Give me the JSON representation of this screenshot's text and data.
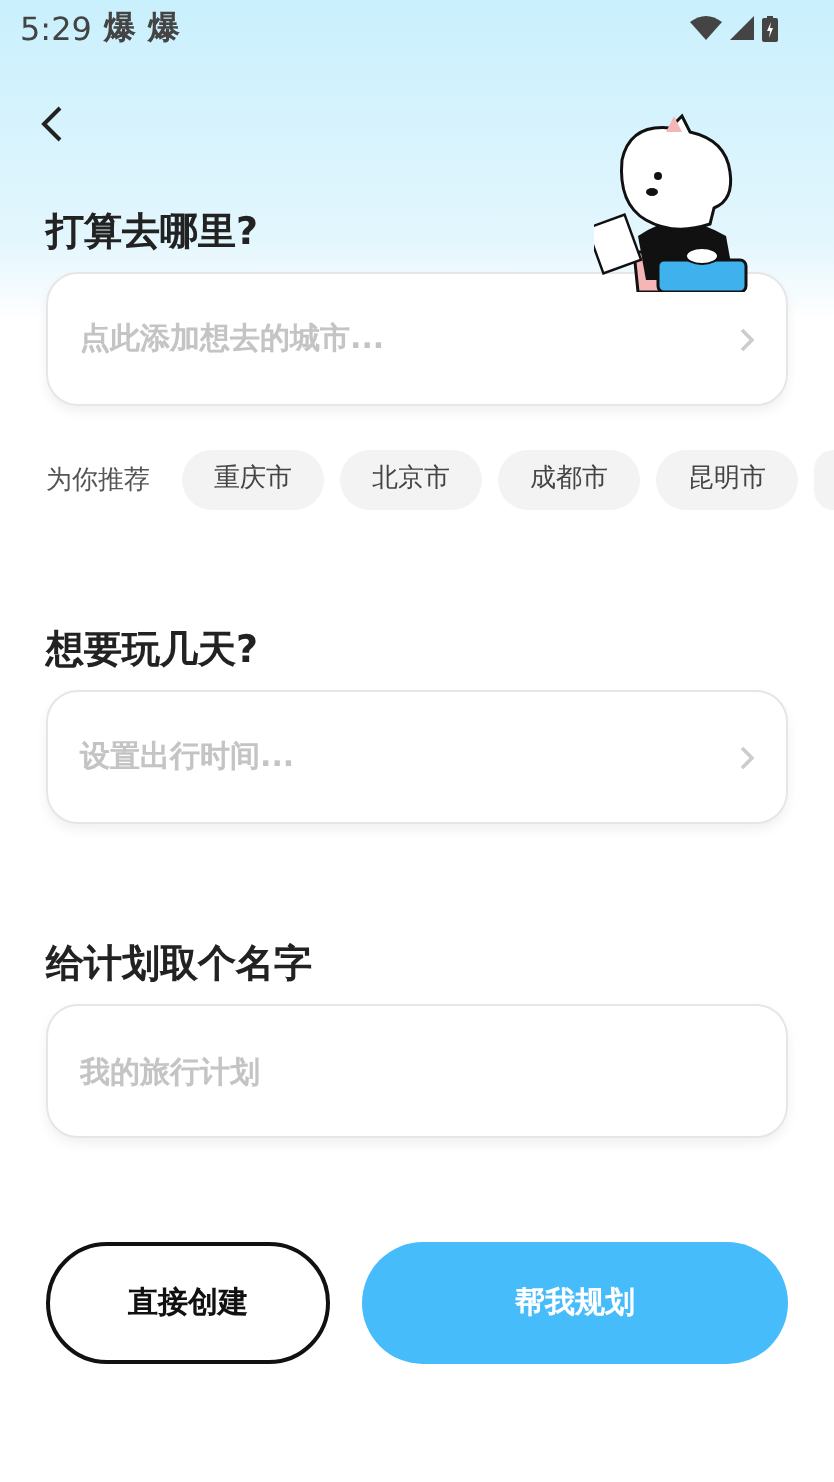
{
  "status_bar": {
    "time": "5:29",
    "notifications": [
      "爆",
      "爆"
    ]
  },
  "sections": [
    {
      "kind": "picker",
      "title": "打算去哪里?",
      "placeholder": "点此添加想去的城市...",
      "recommend_label": "为你推荐",
      "recommendations": [
        "重庆市",
        "北京市",
        "成都市",
        "昆明市"
      ]
    },
    {
      "kind": "picker",
      "title": "想要玩几天?",
      "placeholder": "设置出行时间..."
    },
    {
      "kind": "input",
      "title": "给计划取个名字",
      "placeholder": "我的旅行计划"
    }
  ],
  "buttons": [
    {
      "label": "直接创建",
      "kind": "outline"
    },
    {
      "label": "帮我规划",
      "kind": "primary"
    }
  ]
}
